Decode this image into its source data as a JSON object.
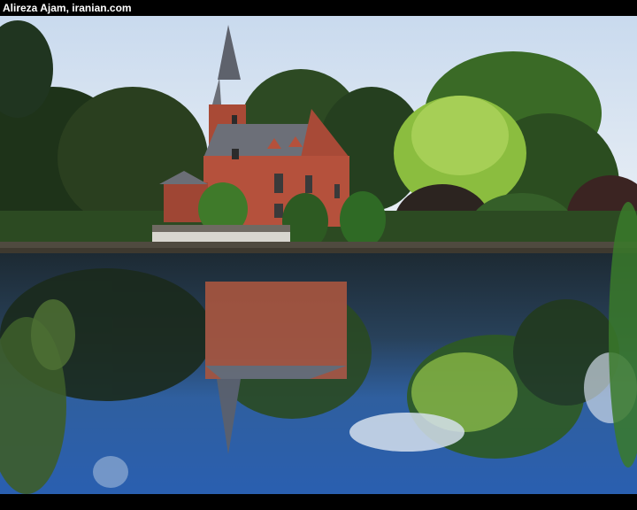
{
  "header": {
    "credit": "Alireza Ajam, iranian.com"
  },
  "photo": {
    "subject": "castle-by-lake",
    "colors": {
      "sky": "#dfe9f4",
      "water": "#2a5ea8",
      "brick": "#b5513c",
      "roof": "#6c6f78",
      "foliage_dark": "#1f3a1c",
      "foliage_light": "#86b83a"
    }
  }
}
